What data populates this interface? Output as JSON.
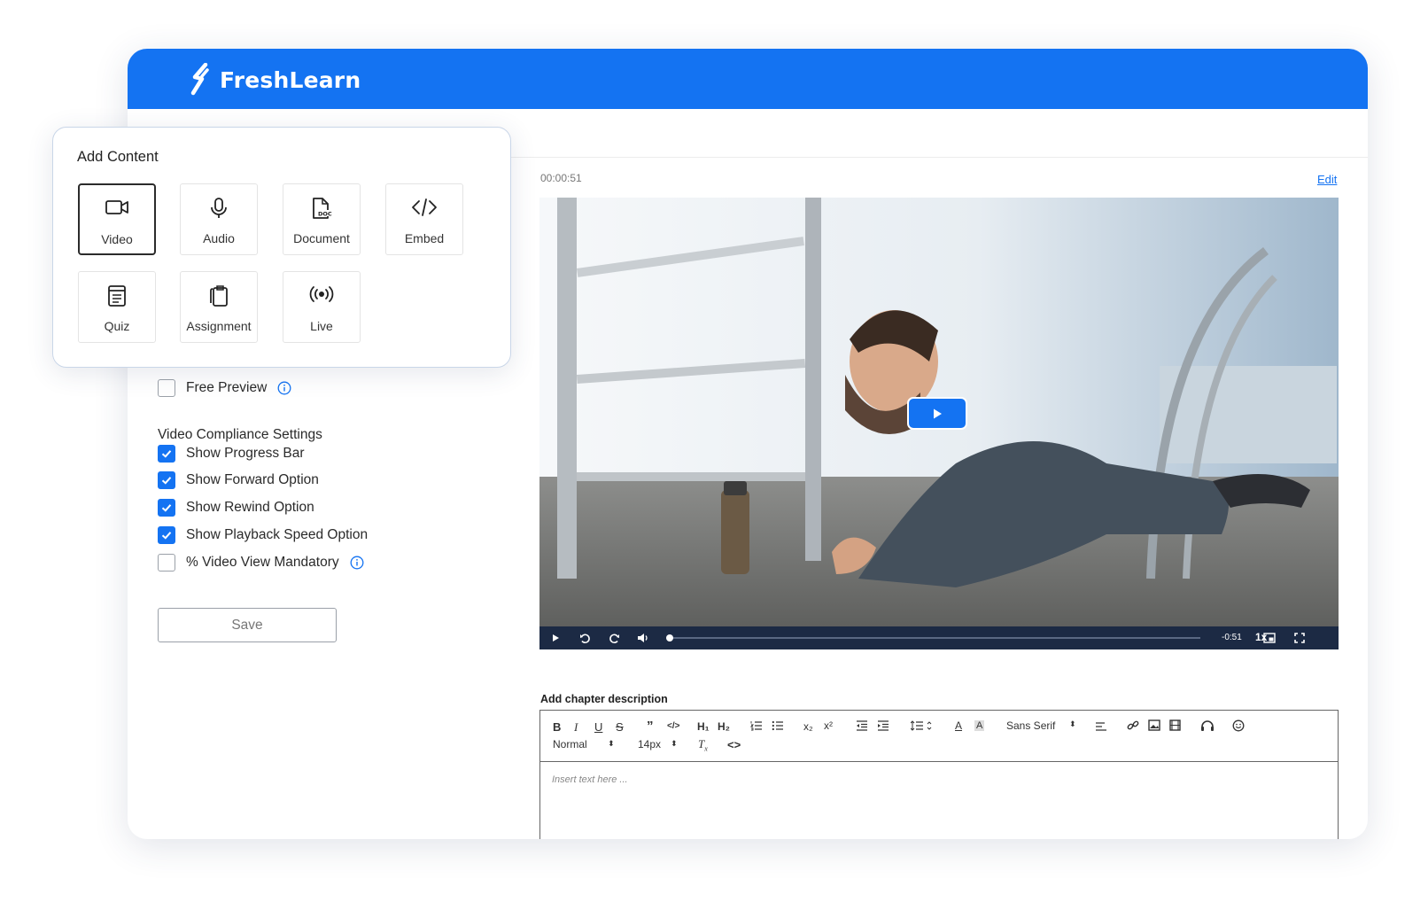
{
  "brand": {
    "name": "FreshLearn",
    "color": "#1473f2"
  },
  "add_content": {
    "title": "Add Content",
    "tiles": [
      {
        "label": "Video",
        "icon": "video-camera-icon",
        "selected": true
      },
      {
        "label": "Audio",
        "icon": "microphone-icon",
        "selected": false
      },
      {
        "label": "Document",
        "icon": "document-icon",
        "selected": false
      },
      {
        "label": "Embed",
        "icon": "code-icon",
        "selected": false
      },
      {
        "label": "Quiz",
        "icon": "quiz-icon",
        "selected": false
      },
      {
        "label": "Assignment",
        "icon": "assignment-icon",
        "selected": false
      },
      {
        "label": "Live",
        "icon": "live-broadcast-icon",
        "selected": false
      }
    ]
  },
  "settings": {
    "free_preview": {
      "label": "Free Preview",
      "checked": false
    },
    "compliance_title": "Video Compliance Settings",
    "options": [
      {
        "label": "Show Progress Bar",
        "checked": true
      },
      {
        "label": "Show Forward Option",
        "checked": true
      },
      {
        "label": "Show Rewind Option",
        "checked": true
      },
      {
        "label": "Show Playback Speed Option",
        "checked": true
      },
      {
        "label": "% Video View Mandatory",
        "checked": false
      }
    ],
    "save_label": "Save"
  },
  "video": {
    "duration": "00:00:51",
    "edit_label": "Edit",
    "remaining": "-0:51",
    "speed": "1x",
    "progress": 0.0
  },
  "editor": {
    "label": "Add chapter description",
    "heading_select": "Normal",
    "size_select": "14px",
    "font_select": "Sans Serif",
    "placeholder": "Insert text here ..."
  }
}
